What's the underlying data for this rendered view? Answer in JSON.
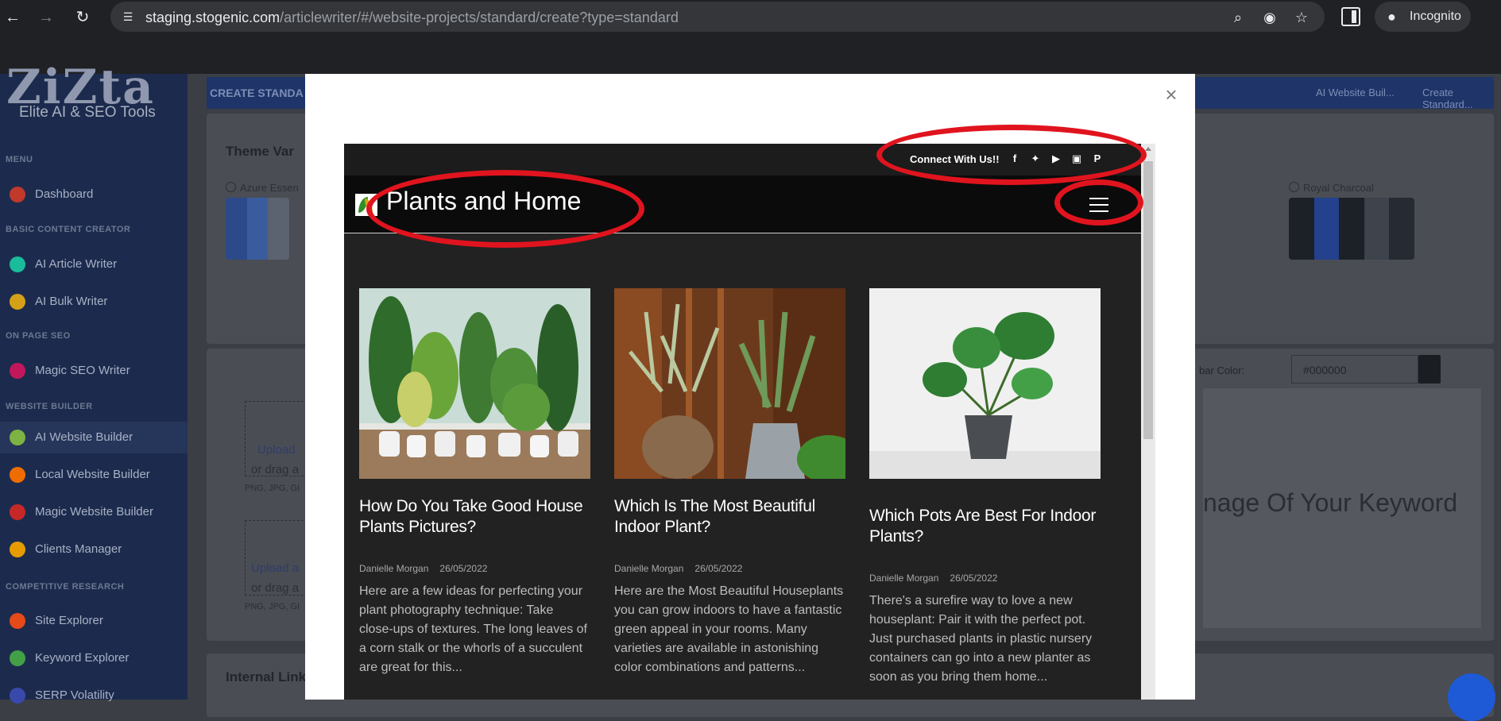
{
  "browser": {
    "url_host": "staging.stogenic.com",
    "url_path": "/articlewriter/#/website-projects/standard/create?type=standard",
    "profile_label": "Incognito"
  },
  "app": {
    "logo_text": "ZiZta",
    "logo_subtitle": "Elite AI & SEO Tools",
    "sidebar": {
      "sections": [
        {
          "heading": "MENU",
          "items": [
            {
              "label": "Dashboard",
              "color": "#c0392b"
            }
          ]
        },
        {
          "heading": "BASIC CONTENT CREATOR",
          "items": [
            {
              "label": "AI Article Writer",
              "color": "#1abc9c"
            },
            {
              "label": "AI Bulk Writer",
              "color": "#d4a017"
            }
          ]
        },
        {
          "heading": "ON PAGE SEO",
          "items": [
            {
              "label": "Magic SEO Writer",
              "color": "#c2185b"
            }
          ]
        },
        {
          "heading": "WEBSITE BUILDER",
          "items": [
            {
              "label": "AI Website Builder",
              "color": "#7cb342"
            },
            {
              "label": "Local Website Builder",
              "color": "#ef6c00"
            },
            {
              "label": "Magic Website Builder",
              "color": "#c62828"
            },
            {
              "label": "Clients Manager",
              "color": "#e69b00"
            }
          ]
        },
        {
          "heading": "COMPETITIVE RESEARCH",
          "items": [
            {
              "label": "Site Explorer",
              "color": "#e64a19"
            },
            {
              "label": "Keyword Explorer",
              "color": "#43a047"
            },
            {
              "label": "SERP Volatility",
              "color": "#3949ab"
            }
          ]
        }
      ]
    },
    "page_title": "CREATE STANDA",
    "breadcrumb": [
      "AI Website Buil...",
      "Create Standard..."
    ],
    "theme_card": {
      "title": "Theme Var",
      "option_left": "Azure Essen",
      "option_right": "Royal Charcoal"
    },
    "upload": {
      "link": "Upload",
      "link2": "Upload a",
      "drag": "or drag a",
      "drag2": "or drag a",
      "formats": "PNG, JPG, GI",
      "formats2": "PNG, JPG, GI"
    },
    "bar_color_label": "bar Color:",
    "bar_color_value": "#000000",
    "preview_text": "nage Of Your Keyword",
    "internal_links_title": "Internal Link"
  },
  "modal": {
    "preview": {
      "connect_text": "Connect With Us!!",
      "social_icons": [
        "facebook-icon",
        "twitter-icon",
        "youtube-icon",
        "instagram-icon",
        "pinterest-icon"
      ],
      "site_name": "Plants and Home",
      "posts": [
        {
          "title": "How Do You Take Good House Plants Pictures?",
          "author": "Danielle Morgan",
          "date": "26/05/2022",
          "excerpt": "Here are a few ideas for perfecting your plant photography technique: Take close-ups of textures. The long leaves of a corn stalk or the whorls of a succulent are great for this..."
        },
        {
          "title": "Which Is The Most Beautiful Indoor Plant?",
          "author": "Danielle Morgan",
          "date": "26/05/2022",
          "excerpt": "Here are the Most Beautiful Houseplants you can grow indoors to have a fantastic green appeal in your rooms. Many varieties are available in astonishing color combinations and patterns..."
        },
        {
          "title": "Which Pots Are Best For Indoor Plants?",
          "author": "Danielle Morgan",
          "date": "26/05/2022",
          "excerpt": "There's a surefire way to love a new houseplant: Pair it with the perfect pot. Just purchased plants in plastic nursery containers can go into a new planter as soon as you bring them home..."
        }
      ]
    }
  }
}
